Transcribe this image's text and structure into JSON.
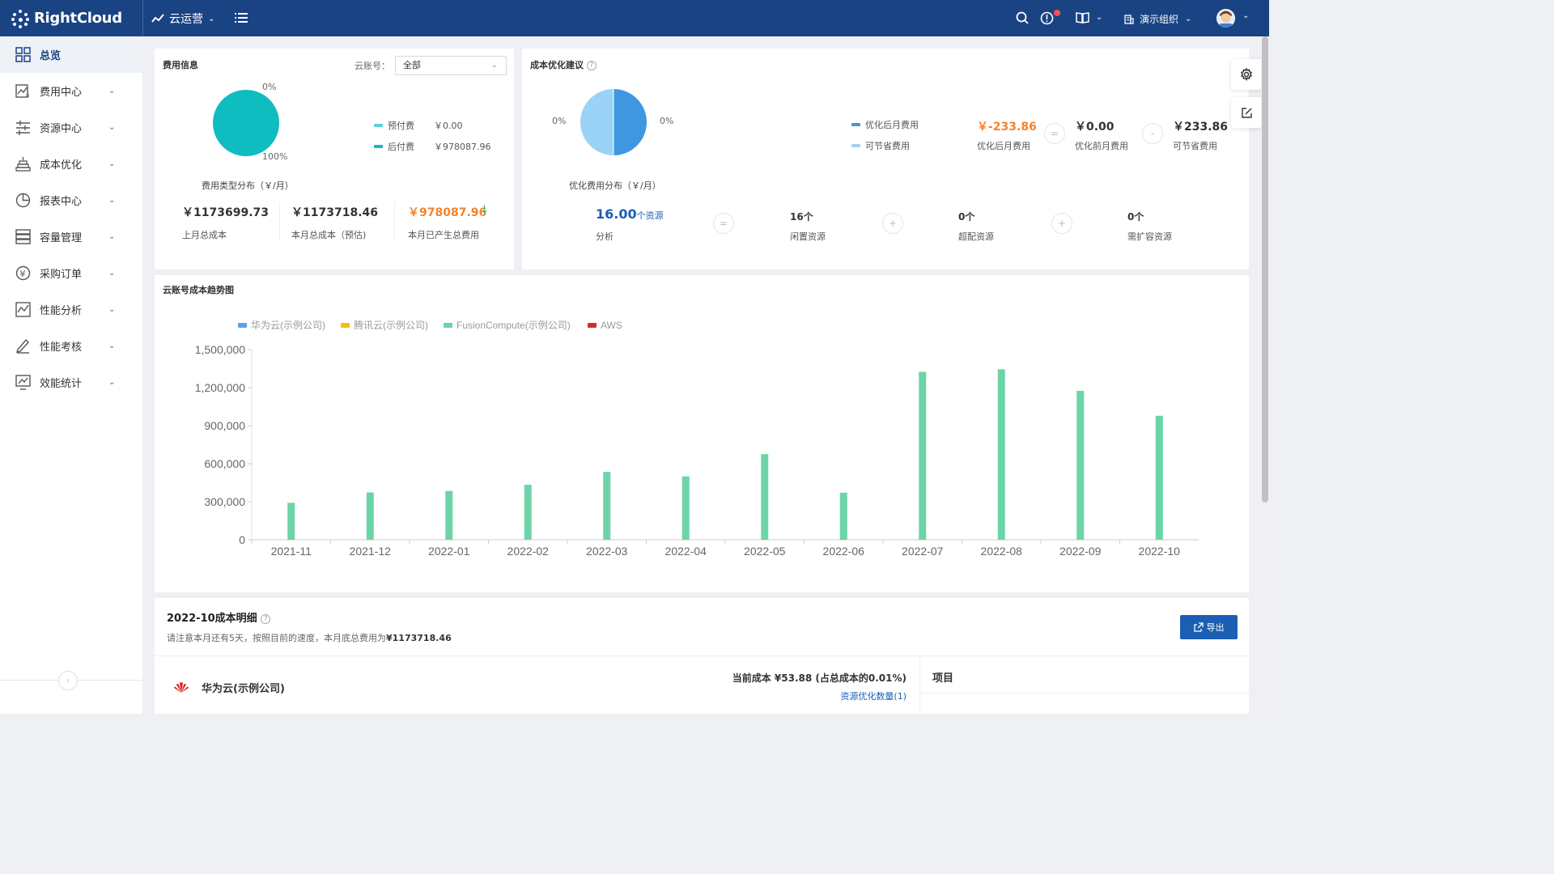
{
  "app": {
    "logo_text": "RightCloud",
    "module": "云运营",
    "org": "演示组织"
  },
  "sidebar": {
    "items": [
      {
        "label": "总览",
        "active": true
      },
      {
        "label": "费用中心"
      },
      {
        "label": "资源中心"
      },
      {
        "label": "成本优化"
      },
      {
        "label": "报表中心"
      },
      {
        "label": "容量管理"
      },
      {
        "label": "采购订单"
      },
      {
        "label": "性能分析"
      },
      {
        "label": "性能考核"
      },
      {
        "label": "效能统计"
      }
    ]
  },
  "fee_info": {
    "title": "费用信息",
    "account_label": "云账号：",
    "account_value": "全部",
    "pie_label_top": "0%",
    "pie_label_bottom": "100%",
    "pie_caption": "费用类型分布（￥/月）",
    "legend": [
      {
        "name": "预付费",
        "value": "￥0.00",
        "color": "#5bd1dc"
      },
      {
        "name": "后付费",
        "value": "￥978087.96",
        "color": "#0fbcc0"
      }
    ],
    "stats": [
      {
        "value": "￥1173699.73",
        "label": "上月总成本"
      },
      {
        "value": "￥1173718.46",
        "label": "本月总成本（预估)"
      },
      {
        "value": "￥978087.96",
        "label": "本月已产生总费用",
        "trend": "↓"
      }
    ]
  },
  "optimize": {
    "title": "成本优化建议",
    "pie_label_left": "0%",
    "pie_label_right": "0%",
    "pie_caption": "优化费用分布（￥/月）",
    "legend": [
      {
        "name": "优化后月费用",
        "color": "#3f97e0"
      },
      {
        "name": "可节省费用",
        "color": "#9bd3f8"
      }
    ],
    "equation": [
      {
        "value": "￥-233.86",
        "label": "优化后月费用"
      },
      {
        "op": "="
      },
      {
        "value": "￥0.00",
        "label": "优化前月费用"
      },
      {
        "op": "-"
      },
      {
        "value": "￥233.86",
        "label": "可节省费用"
      }
    ],
    "resources": {
      "total_value": "16.00",
      "total_unit": "个资源",
      "total_label": "分析",
      "op1": "=",
      "idle_value": "16个",
      "idle_label": "闲置资源",
      "op2": "+",
      "over_value": "0个",
      "over_label": "超配资源",
      "op3": "+",
      "expand_value": "0个",
      "expand_label": "需扩容资源"
    }
  },
  "trend": {
    "title": "云账号成本趋势图"
  },
  "chart_data": {
    "type": "bar",
    "title": "云账号成本趋势图",
    "categories": [
      "2021-11",
      "2021-12",
      "2022-01",
      "2022-02",
      "2022-03",
      "2022-04",
      "2022-05",
      "2022-06",
      "2022-07",
      "2022-08",
      "2022-09",
      "2022-10"
    ],
    "series": [
      {
        "name": "华为云(示例公司)",
        "color": "#5ba3e6",
        "values": [
          0,
          0,
          0,
          0,
          0,
          0,
          0,
          0,
          0,
          0,
          0,
          0
        ]
      },
      {
        "name": "腾讯云(示例公司)",
        "color": "#f6bd16",
        "values": [
          0,
          0,
          0,
          0,
          0,
          0,
          0,
          0,
          0,
          0,
          0,
          0
        ]
      },
      {
        "name": "FusionCompute(示例公司)",
        "color": "#6dd4a8",
        "values": [
          292000,
          373000,
          385000,
          434000,
          535000,
          500000,
          675000,
          372000,
          1325000,
          1345000,
          1175000,
          978000
        ]
      },
      {
        "name": "AWS",
        "color": "#d0312d",
        "values": [
          0,
          0,
          0,
          0,
          0,
          0,
          0,
          0,
          0,
          0,
          0,
          0
        ]
      }
    ],
    "yticks": [
      "1,500,000",
      "1,200,000",
      "900,000",
      "600,000",
      "300,000",
      "0"
    ],
    "ylim": [
      0,
      1500000
    ],
    "grid": false,
    "legend": "top-left"
  },
  "detail": {
    "title": "2022-10成本明细",
    "notice_prefix": "请注意本月还有5天，按照目前的速度，本月底总费用为",
    "notice_value": "¥1173718.46",
    "export_label": "导出",
    "provider_name": "华为云(示例公司)",
    "current_cost": "当前成本 ¥53.88 (占总成本的0.01%)",
    "optimize_link": "资源优化数量(1)",
    "right_header": "项目"
  }
}
